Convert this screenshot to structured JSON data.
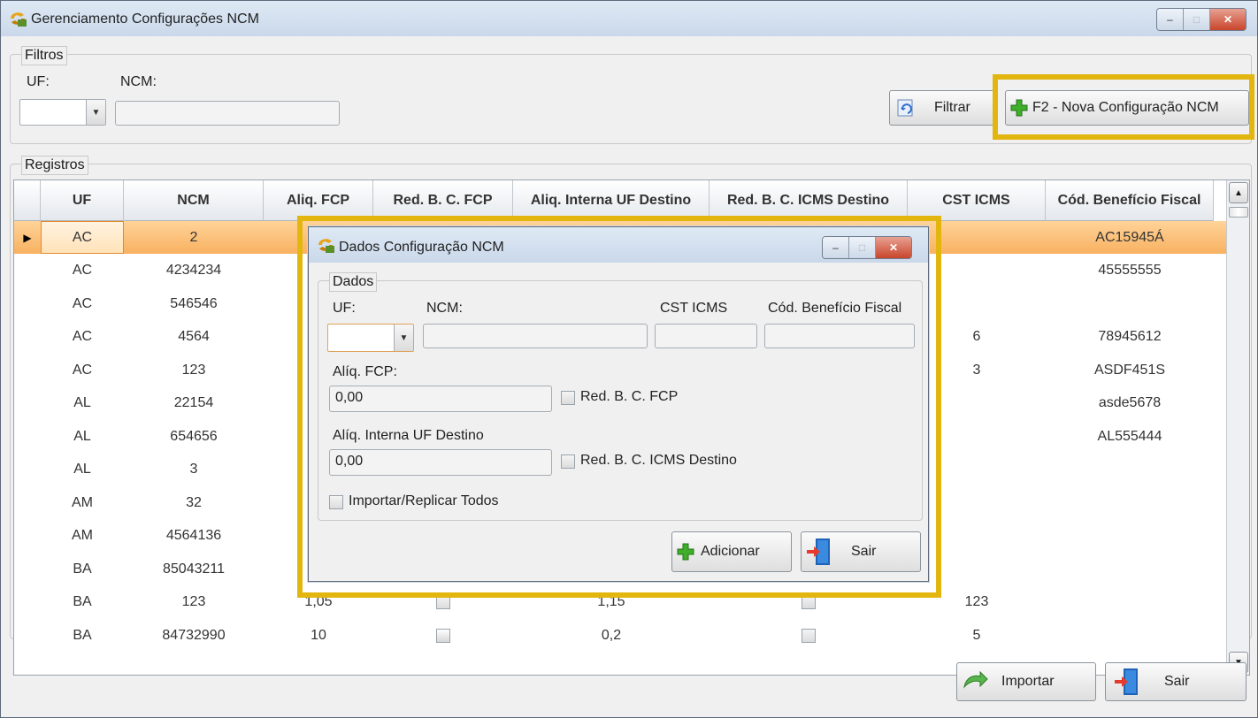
{
  "window": {
    "title": "Gerenciamento Configurações NCM",
    "minimize": "–",
    "maximize": "□",
    "close": "✕"
  },
  "filters": {
    "legend": "Filtros",
    "uf_label": "UF:",
    "ncm_label": "NCM:",
    "uf_value": "",
    "ncm_value": "",
    "filter_button": "Filtrar",
    "new_button": "F2 - Nova Configuração NCM"
  },
  "records": {
    "legend": "Registros",
    "columns": [
      "UF",
      "NCM",
      "Aliq. FCP",
      "Red. B. C. FCP",
      "Aliq. Interna UF Destino",
      "Red. B. C. ICMS Destino",
      "CST ICMS",
      "Cód. Benefício Fiscal"
    ],
    "rows": [
      {
        "uf": "AC",
        "ncm": "2",
        "aliq_fcp": "",
        "red_fcp": "",
        "aliq_int": "",
        "red_icms": "",
        "cst": "",
        "beneficio": "AC15945Á",
        "selected": true
      },
      {
        "uf": "AC",
        "ncm": "4234234",
        "aliq_fcp": "",
        "red_fcp": "",
        "aliq_int": "",
        "red_icms": "",
        "cst": "",
        "beneficio": "45555555"
      },
      {
        "uf": "AC",
        "ncm": "546546",
        "aliq_fcp": "",
        "red_fcp": "",
        "aliq_int": "",
        "red_icms": "",
        "cst": "",
        "beneficio": ""
      },
      {
        "uf": "AC",
        "ncm": "4564",
        "aliq_fcp": "",
        "red_fcp": "",
        "aliq_int": "",
        "red_icms": "",
        "cst": "6",
        "beneficio": "78945612"
      },
      {
        "uf": "AC",
        "ncm": "123",
        "aliq_fcp": "",
        "red_fcp": "",
        "aliq_int": "",
        "red_icms": "",
        "cst": "3",
        "beneficio": "ASDF451S"
      },
      {
        "uf": "AL",
        "ncm": "22154",
        "aliq_fcp": "",
        "red_fcp": "",
        "aliq_int": "",
        "red_icms": "",
        "cst": "",
        "beneficio": "asde5678"
      },
      {
        "uf": "AL",
        "ncm": "654656",
        "aliq_fcp": "",
        "red_fcp": "",
        "aliq_int": "",
        "red_icms": "",
        "cst": "",
        "beneficio": "AL555444"
      },
      {
        "uf": "AL",
        "ncm": "3",
        "aliq_fcp": "",
        "red_fcp": "",
        "aliq_int": "",
        "red_icms": "",
        "cst": "",
        "beneficio": ""
      },
      {
        "uf": "AM",
        "ncm": "32",
        "aliq_fcp": "",
        "red_fcp": "",
        "aliq_int": "",
        "red_icms": "",
        "cst": "",
        "beneficio": ""
      },
      {
        "uf": "AM",
        "ncm": "4564136",
        "aliq_fcp": "",
        "red_fcp": "",
        "aliq_int": "",
        "red_icms": "",
        "cst": "",
        "beneficio": ""
      },
      {
        "uf": "BA",
        "ncm": "85043211",
        "aliq_fcp": "",
        "red_fcp": "",
        "aliq_int": "",
        "red_icms": "",
        "cst": "",
        "beneficio": ""
      },
      {
        "uf": "BA",
        "ncm": "123",
        "aliq_fcp": "1,05",
        "red_fcp": "off",
        "aliq_int": "1,15",
        "red_icms": "off",
        "cst": "123",
        "beneficio": ""
      },
      {
        "uf": "BA",
        "ncm": "84732990",
        "aliq_fcp": "10",
        "red_fcp": "on",
        "aliq_int": "0,2",
        "red_icms": "off",
        "cst": "5",
        "beneficio": ""
      }
    ]
  },
  "bottom": {
    "import_button": "Importar",
    "exit_button": "Sair"
  },
  "dialog": {
    "title": "Dados Configuração NCM",
    "legend": "Dados",
    "uf_label": "UF:",
    "ncm_label": "NCM:",
    "cst_label": "CST ICMS",
    "beneficio_label": "Cód. Benefício Fiscal",
    "aliq_fcp_label": "Alíq. FCP:",
    "aliq_fcp_value": "0,00",
    "red_fcp_label": "Red. B. C. FCP",
    "aliq_int_label": "Alíq. Interna UF Destino",
    "aliq_int_value": "0,00",
    "red_icms_label": "Red. B. C. ICMS Destino",
    "import_all_label": "Importar/Replicar Todos",
    "add_button": "Adicionar",
    "exit_button": "Sair"
  },
  "colors": {
    "highlight": "#e2b60f",
    "selected_row": "#f8b160"
  }
}
